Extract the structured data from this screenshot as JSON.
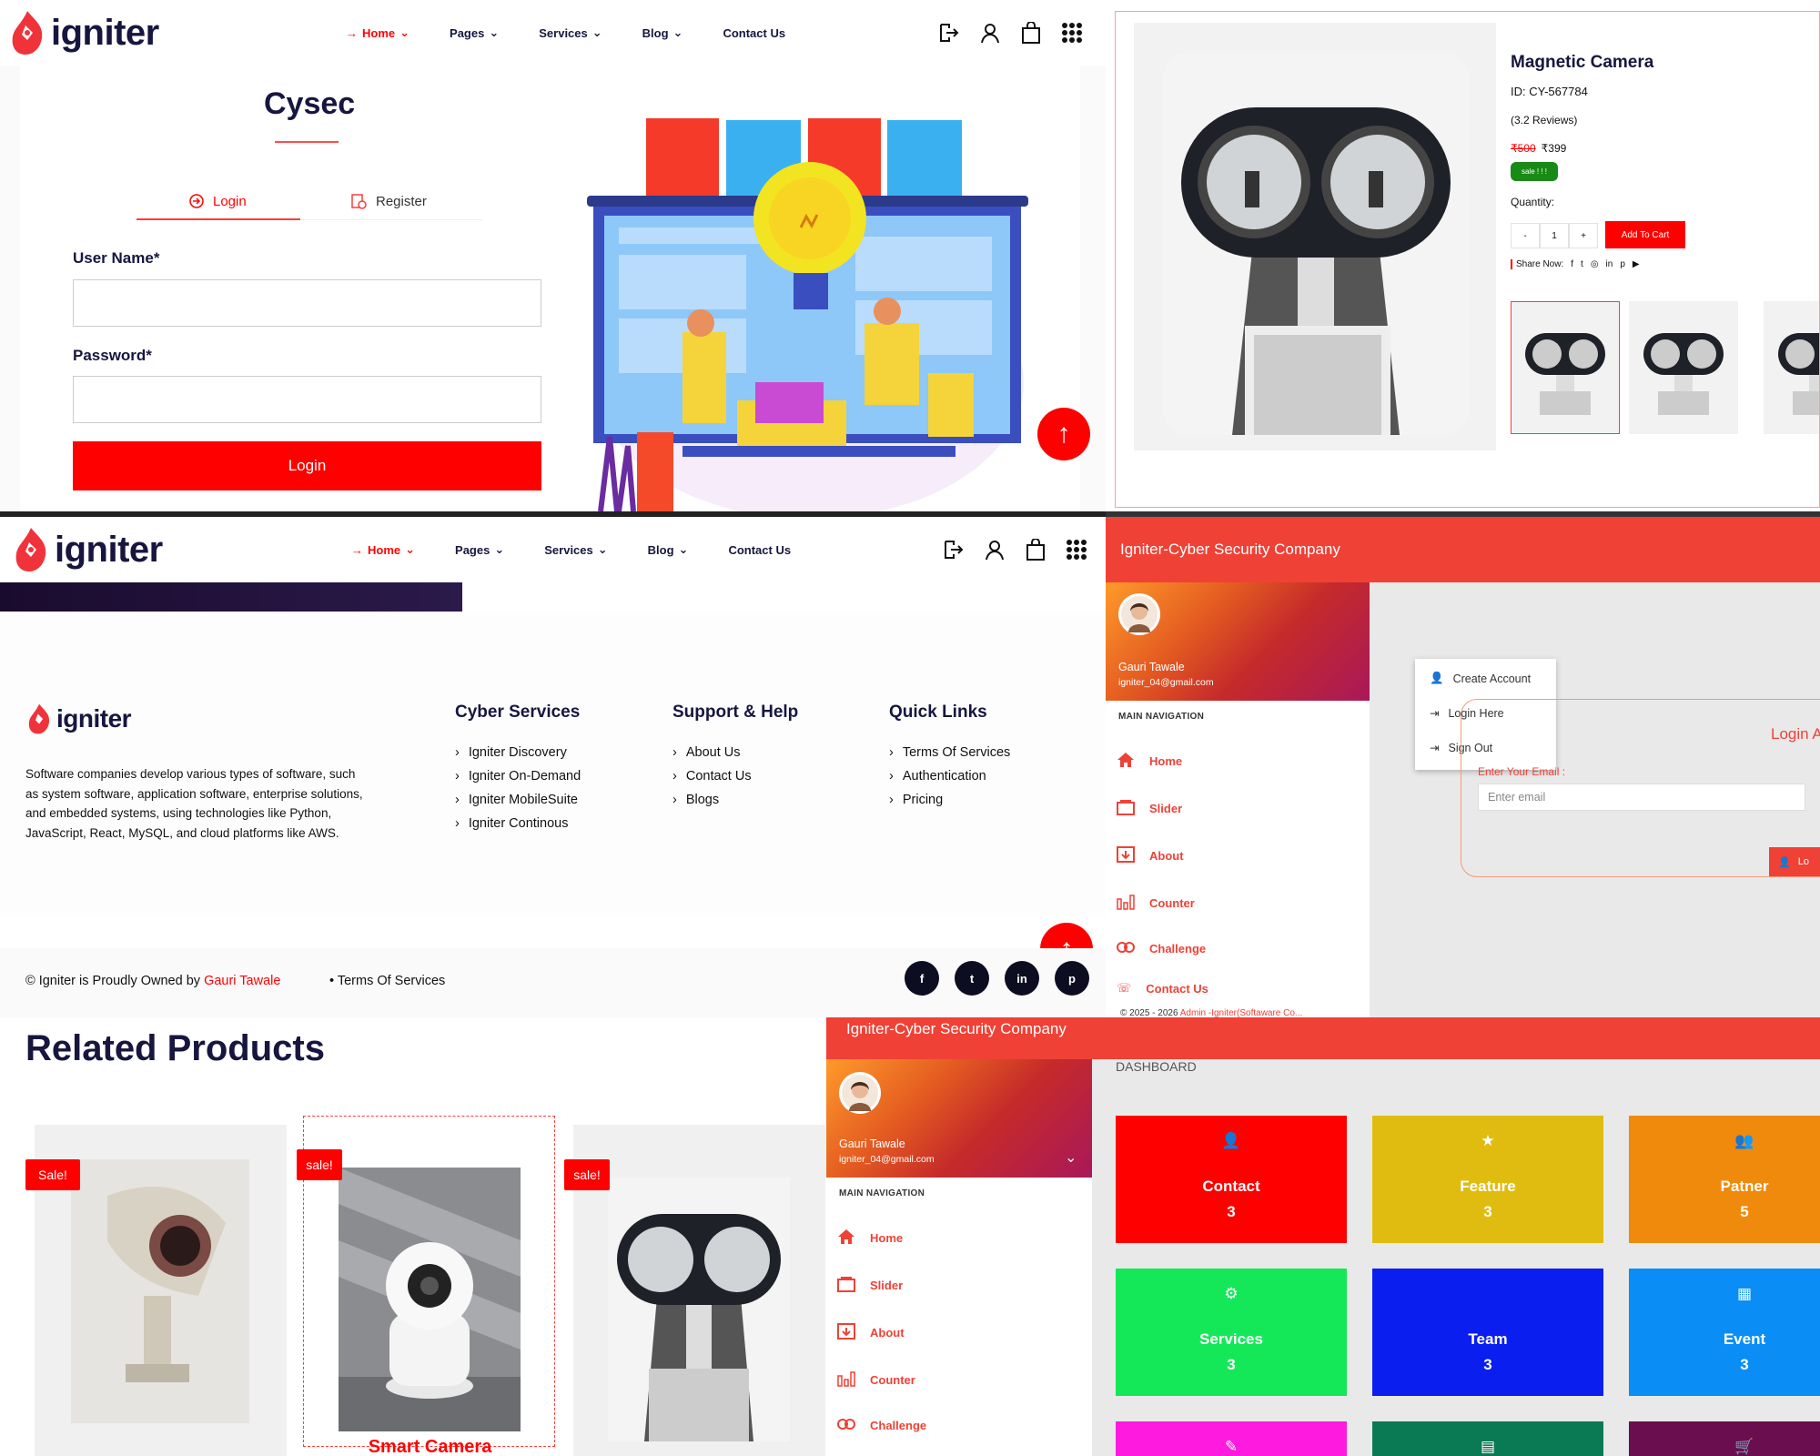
{
  "brand": {
    "name": "igniter"
  },
  "nav": {
    "items": [
      "Home",
      "Pages",
      "Services",
      "Blog",
      "Contact Us"
    ]
  },
  "login_page": {
    "title": "Cysec",
    "tab_login": "Login",
    "tab_register": "Register",
    "username_label": "User Name*",
    "password_label": "Password*",
    "submit": "Login"
  },
  "product": {
    "title": "Magnetic Camera",
    "id": "ID: CY-567784",
    "reviews": "(3.2 Reviews)",
    "old_price": "₹500",
    "price": "₹399",
    "badge": "sale ! ! !",
    "quantity_label": "Quantity:",
    "qty_minus": "-",
    "qty_value": "1",
    "qty_plus": "+",
    "add_to_cart": "Add To Cart",
    "share_label": "Share Now:"
  },
  "footer": {
    "description": "Software companies develop various types of software, such as system software, application software, enterprise solutions, and embedded systems, using technologies like Python, JavaScript, React, MySQL, and cloud platforms like AWS.",
    "col1": {
      "title": "Cyber Services",
      "items": [
        "Igniter Discovery",
        "Igniter On-Demand",
        "Igniter MobileSuite",
        "Igniter Continous"
      ]
    },
    "col2": {
      "title": "Support & Help",
      "items": [
        "About Us",
        "Contact Us",
        "Blogs"
      ]
    },
    "col3": {
      "title": "Quick Links",
      "items": [
        "Terms Of Services",
        "Authentication",
        "Pricing"
      ]
    },
    "copyright": "© Igniter is Proudly Owned by",
    "owner": "Gauri Tawale",
    "terms": "Terms Of Services"
  },
  "admin": {
    "company": "Igniter-Cyber Security Company",
    "user_name": "Gauri Tawale",
    "user_email": "igniter_04@gmail.com",
    "main_nav": "MAIN NAVIGATION",
    "menu": [
      "Home",
      "Slider",
      "About",
      "Counter",
      "Challenge",
      "Contact Us"
    ],
    "dropdown": [
      "Create Account",
      "Login Here",
      "Sign Out"
    ],
    "login_title": "Login A",
    "email_label": "Enter Your Email :",
    "email_placeholder": "Enter email",
    "login_button": "Lo",
    "footer_prefix": "© 2025 - 2026",
    "footer_link": "Admin -Igniter(Softaware Co..."
  },
  "related": {
    "title": "Related Products",
    "badges": [
      "Sale!",
      "sale!",
      "sale!"
    ],
    "names": [
      "",
      "Smart Camera",
      ""
    ]
  },
  "dashboard": {
    "label": "DASHBOARD",
    "tiles": [
      {
        "name": "Contact",
        "value": "3",
        "color": "#ff0000",
        "icon": "user-icon"
      },
      {
        "name": "Feature",
        "value": "3",
        "color": "#e0bc10",
        "icon": "star-icon"
      },
      {
        "name": "Patner",
        "value": "5",
        "color": "#f08a0c",
        "icon": "group-icon"
      },
      {
        "name": "Services",
        "value": "3",
        "color": "#14e858",
        "icon": "gear-icon"
      },
      {
        "name": "Team",
        "value": "3",
        "color": "#0a1ef0",
        "icon": "team-icon"
      },
      {
        "name": "Event",
        "value": "3",
        "color": "#0a8ef5",
        "icon": "calendar-icon"
      }
    ]
  }
}
